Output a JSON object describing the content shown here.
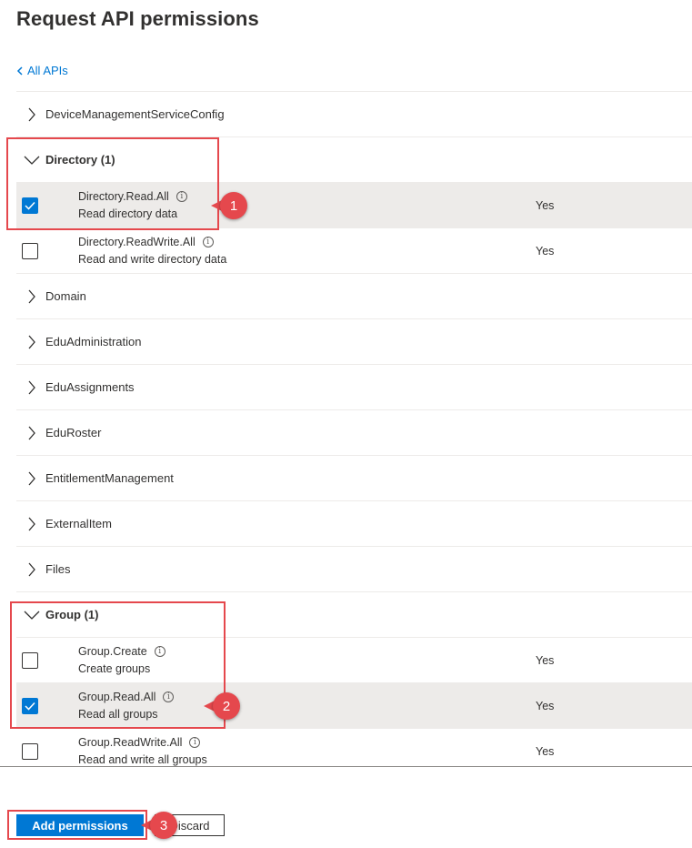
{
  "title": "Request API permissions",
  "back_link": "All APIs",
  "api_groups": [
    {
      "label": "DeviceManagementServiceConfig",
      "expanded": false
    },
    {
      "label": "Directory (1)",
      "expanded": true,
      "permissions": [
        {
          "name": "Directory.Read.All",
          "description": "Read directory data",
          "admin_consent": "Yes",
          "checked": true
        },
        {
          "name": "Directory.ReadWrite.All",
          "description": "Read and write directory data",
          "admin_consent": "Yes",
          "checked": false
        }
      ]
    },
    {
      "label": "Domain",
      "expanded": false
    },
    {
      "label": "EduAdministration",
      "expanded": false
    },
    {
      "label": "EduAssignments",
      "expanded": false
    },
    {
      "label": "EduRoster",
      "expanded": false
    },
    {
      "label": "EntitlementManagement",
      "expanded": false
    },
    {
      "label": "ExternalItem",
      "expanded": false
    },
    {
      "label": "Files",
      "expanded": false
    },
    {
      "label": "Group (1)",
      "expanded": true,
      "permissions": [
        {
          "name": "Group.Create",
          "description": "Create groups",
          "admin_consent": "Yes",
          "checked": false
        },
        {
          "name": "Group.Read.All",
          "description": "Read all groups",
          "admin_consent": "Yes",
          "checked": true
        },
        {
          "name": "Group.ReadWrite.All",
          "description": "Read and write all groups",
          "admin_consent": "Yes",
          "checked": false
        }
      ]
    }
  ],
  "buttons": {
    "add": "Add permissions",
    "discard": "Discard"
  },
  "annotations": {
    "step1": "1",
    "step2": "2",
    "step3": "3"
  },
  "colors": {
    "accent": "#0078d4",
    "annotation": "#e5484d",
    "selected_row": "#edebe9"
  }
}
